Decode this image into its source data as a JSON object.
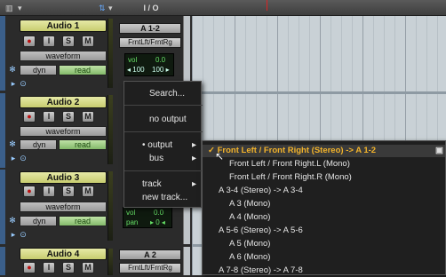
{
  "header": {
    "io_label": "I / O"
  },
  "tracks": [
    {
      "name": "Audio 1",
      "buttons": [
        "●",
        "I",
        "S",
        "M"
      ],
      "view": "waveform",
      "dyn": "dyn",
      "automation": "read",
      "input": "A 1-2",
      "output": "FrntLft/FrntRg",
      "vol_label": "vol",
      "vol_value": "0.0",
      "pan_left": "◂ 100",
      "pan_right": "100 ▸"
    },
    {
      "name": "Audio 2",
      "buttons": [
        "●",
        "I",
        "S",
        "M"
      ],
      "view": "waveform",
      "dyn": "dyn",
      "automation": "read"
    },
    {
      "name": "Audio 3",
      "buttons": [
        "●",
        "I",
        "S",
        "M"
      ],
      "view": "waveform",
      "dyn": "dyn",
      "automation": "read",
      "vol_label": "vol",
      "vol_value": "0.0",
      "pan_label": "pan",
      "pan_value": "▸ 0 ◂"
    },
    {
      "name": "Audio 4",
      "buttons": [
        "●",
        "I",
        "S",
        "M"
      ],
      "input": "A 2",
      "output": "FrntLft/FrntRg"
    }
  ],
  "menu": {
    "search": "Search...",
    "no_output": "no output",
    "output": "output",
    "bus": "bus",
    "track": "track",
    "new_track": "new track..."
  },
  "submenu": {
    "items": [
      "Front Left / Front Right (Stereo) -> A 1-2",
      "Front Left / Front Right.L (Mono)",
      "Front Left / Front Right.R (Mono)",
      "A 3-4 (Stereo) -> A 3-4",
      "A 3 (Mono)",
      "A 4 (Mono)",
      "A 5-6 (Stereo) -> A 5-6",
      "A 5 (Mono)",
      "A 6 (Mono)",
      "A 7-8 (Stereo) -> A 7-8"
    ],
    "selected_index": 0
  },
  "colors": {
    "accent": "#f2b32b",
    "track_name_bg": "#d7dc8a",
    "automation_read": "#9fd081",
    "timeline": "#c9d1d6"
  }
}
